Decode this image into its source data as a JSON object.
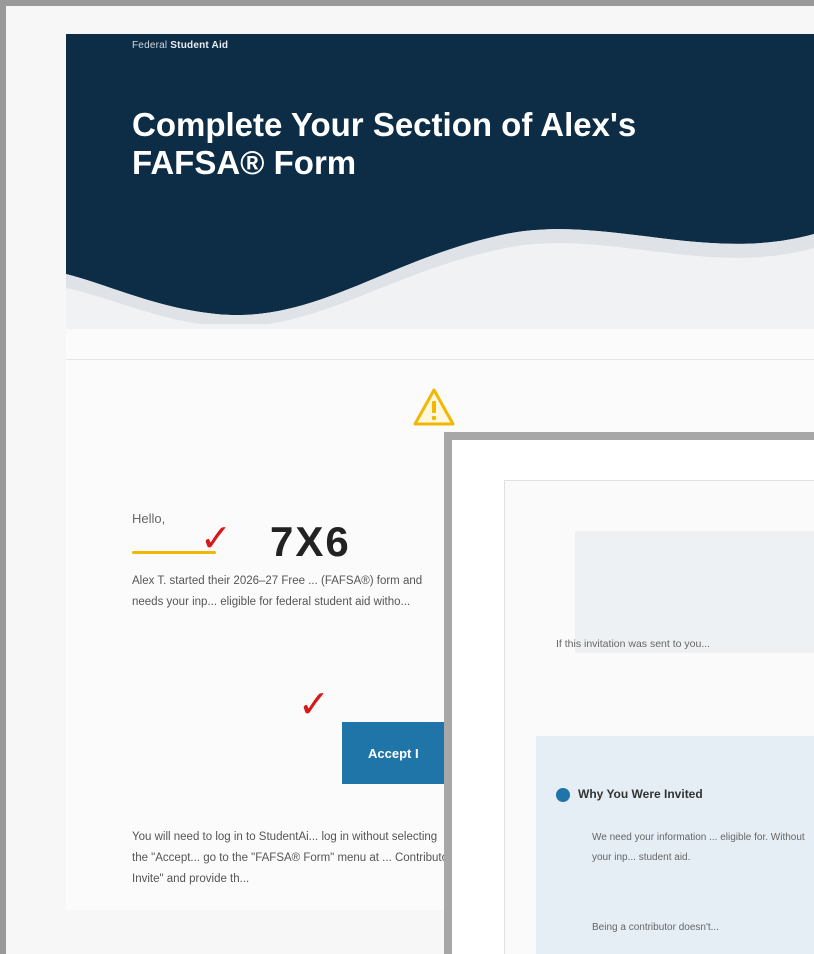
{
  "email": {
    "brand_prefix": "Federal",
    "brand_name": "Student Aid",
    "title": "Complete Your Section of Alex's FAFSA® Form",
    "greeting": "Hello,",
    "paragraph_1": "Alex T. started their 2026–27 Free ... (FAFSA®) form and needs your inp... eligible for federal student aid witho...",
    "accept_button_label": "Accept I",
    "paragraph_2": "You will need to log in to StudentAi... log in without selecting the \"Accept... go to the \"FAFSA® Form\" menu at ... Contributor Invite\" and provide th..."
  },
  "invite_overlay": {
    "code": "7X6",
    "note": "If this invitation was sent to you...",
    "info_heading": "Why You Were Invited",
    "info_body": "We need your information ... eligible for. Without your inp... student aid.",
    "info_body_2": "Being a contributor doesn't..."
  },
  "annotations": {
    "checkmark": "✓"
  },
  "icons": {
    "warning": "warning-icon",
    "info": "info-icon"
  },
  "colors": {
    "banner": "#0c2d45",
    "accent": "#f2b705",
    "button": "#1f74a8",
    "check": "#d61a1a"
  }
}
